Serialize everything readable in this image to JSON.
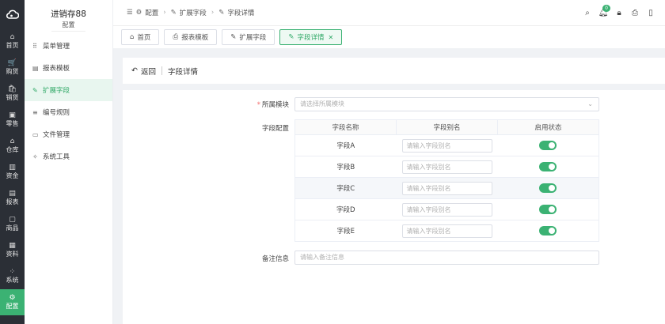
{
  "rail": {
    "items": [
      {
        "icon": "⌂",
        "label": "首页"
      },
      {
        "icon": "🛒",
        "label": "购货"
      },
      {
        "icon": "🛍",
        "label": "销货"
      },
      {
        "icon": "▣",
        "label": "零售"
      },
      {
        "icon": "⌂",
        "label": "仓库"
      },
      {
        "icon": "▥",
        "label": "资金"
      },
      {
        "icon": "▤",
        "label": "报表"
      },
      {
        "icon": "▢",
        "label": "商品"
      },
      {
        "icon": "▦",
        "label": "资料"
      },
      {
        "icon": "⁘",
        "label": "系统"
      },
      {
        "icon": "⚙",
        "label": "配置"
      }
    ]
  },
  "sidebar": {
    "title": "进销存88",
    "subtitle": "配置",
    "items": [
      {
        "icon": "⠿",
        "label": "菜单管理"
      },
      {
        "icon": "▤",
        "label": "报表模板"
      },
      {
        "icon": "✎",
        "label": "扩展字段"
      },
      {
        "icon": "≡",
        "label": "编号规则"
      },
      {
        "icon": "▭",
        "label": "文件管理"
      },
      {
        "icon": "✧",
        "label": "系统工具"
      }
    ]
  },
  "breadcrumb": {
    "items": [
      "配置",
      "扩展字段",
      "字段详情"
    ]
  },
  "header": {
    "notification_count": "0"
  },
  "tabs": [
    {
      "label": "首页"
    },
    {
      "label": "报表模板"
    },
    {
      "label": "扩展字段"
    },
    {
      "label": "字段详情"
    }
  ],
  "page": {
    "back_label": "返回",
    "title": "字段详情"
  },
  "form": {
    "module_label": "所属模块",
    "module_placeholder": "请选择所属模块",
    "fields_label": "字段配置",
    "columns": [
      "字段名称",
      "字段别名",
      "启用状态"
    ],
    "rows": [
      {
        "name": "字段A",
        "alias_placeholder": "请输入字段别名",
        "enabled": true
      },
      {
        "name": "字段B",
        "alias_placeholder": "请输入字段别名",
        "enabled": true
      },
      {
        "name": "字段C",
        "alias_placeholder": "请输入字段别名",
        "enabled": true
      },
      {
        "name": "字段D",
        "alias_placeholder": "请输入字段别名",
        "enabled": true
      },
      {
        "name": "字段E",
        "alias_placeholder": "请输入字段别名",
        "enabled": true
      }
    ],
    "remark_label": "备注信息",
    "remark_placeholder": "请输入备注信息"
  },
  "colors": {
    "accent": "#3bb273",
    "rail_bg": "#2b2f36"
  }
}
